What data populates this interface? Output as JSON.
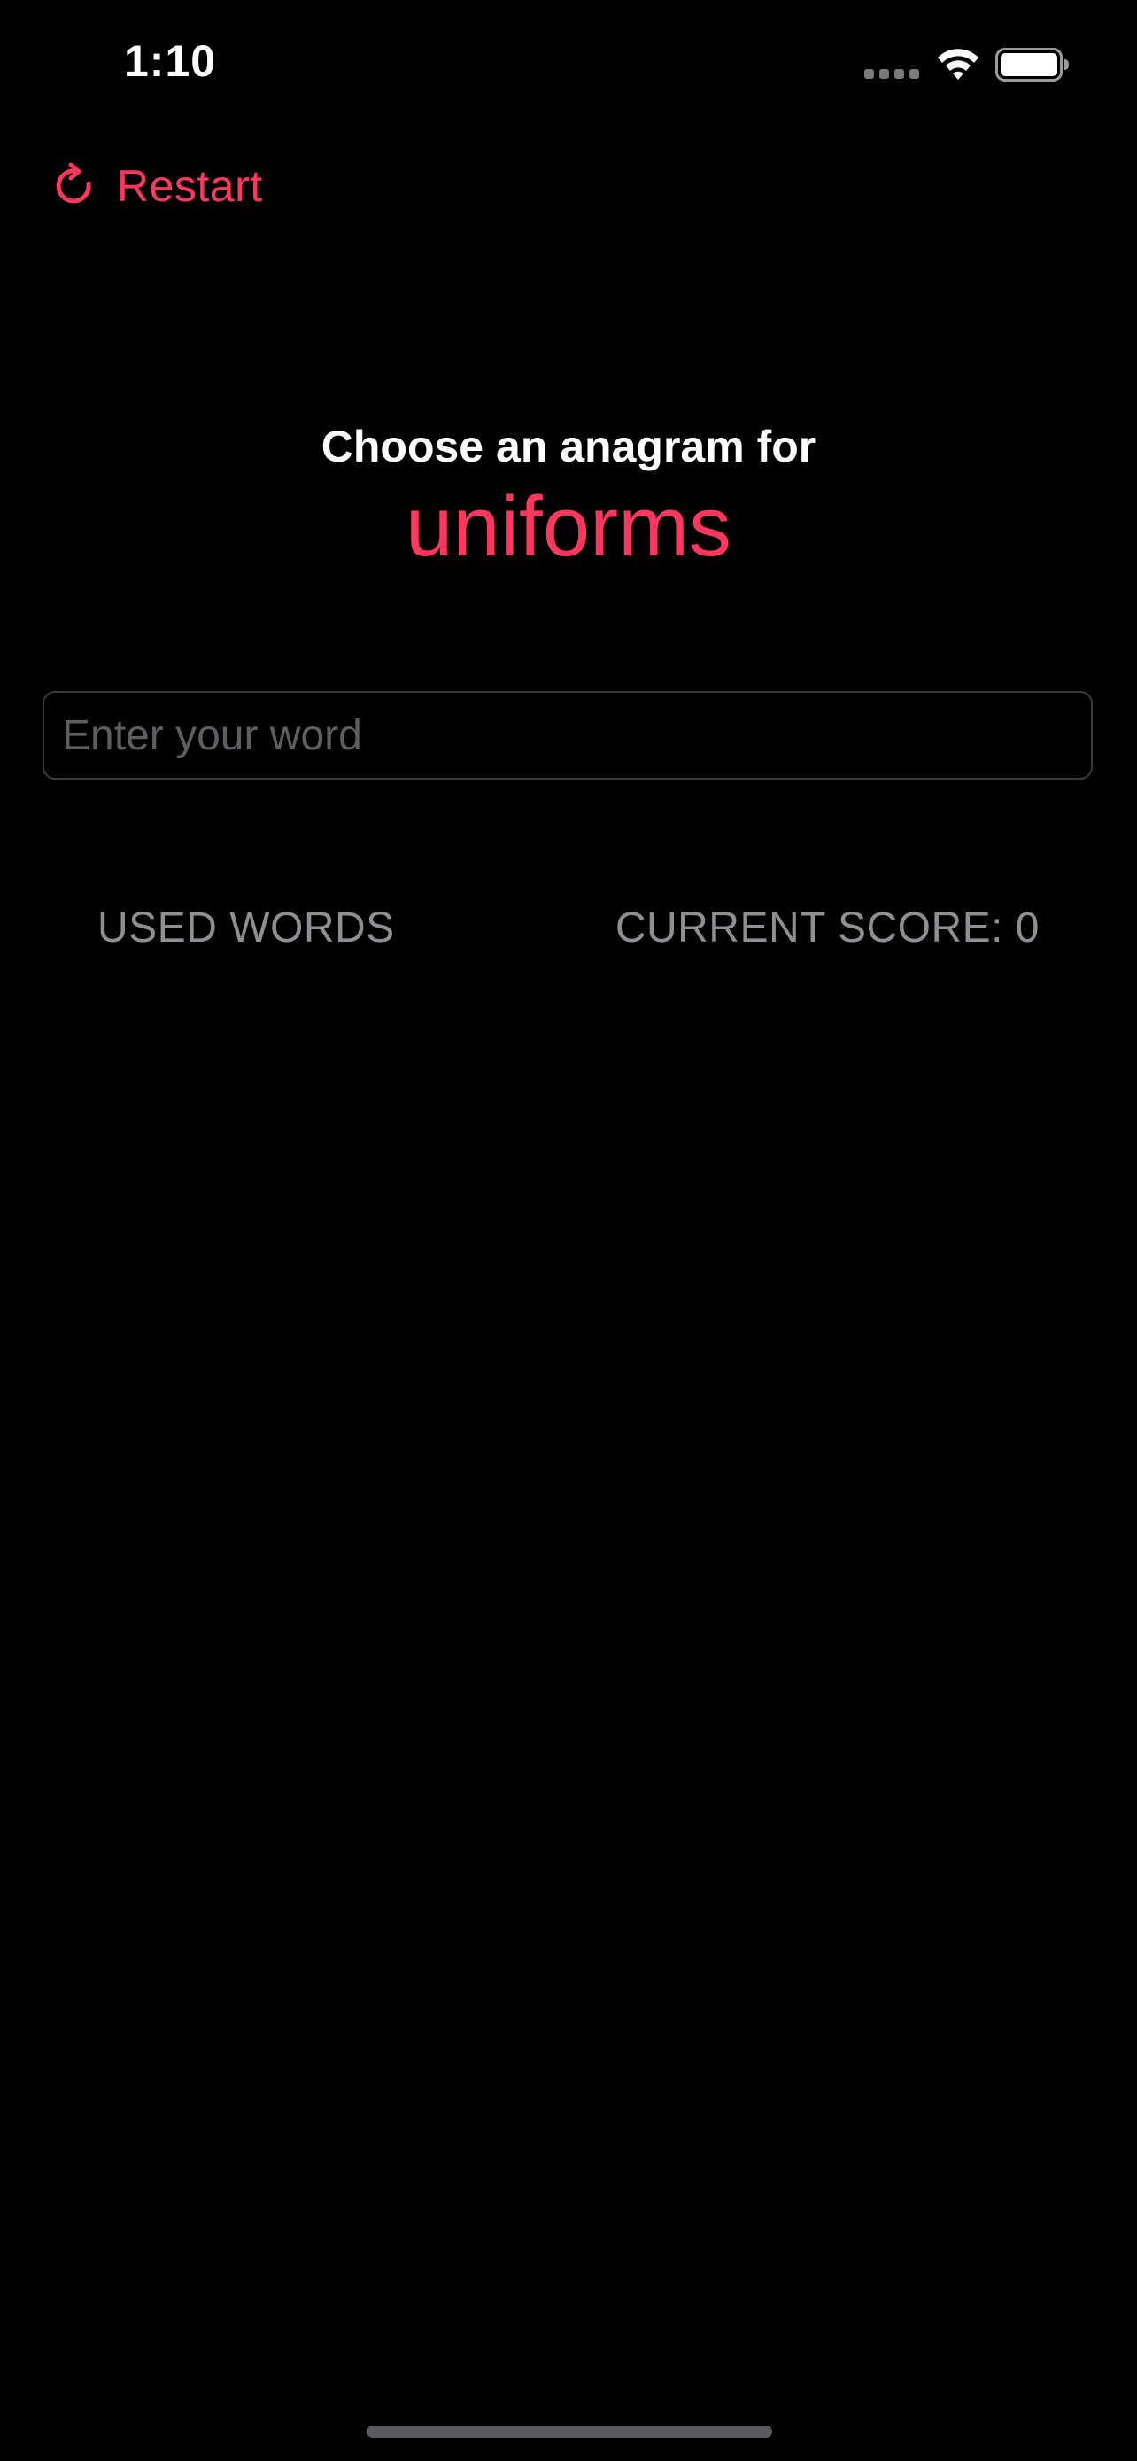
{
  "status_bar": {
    "time": "1:10",
    "icons": [
      "cellular-signal-icon",
      "wifi-icon",
      "battery-icon"
    ]
  },
  "toolbar": {
    "restart_label": "Restart",
    "restart_icon": "arrow-clockwise-icon"
  },
  "game": {
    "prompt": "Choose an anagram for",
    "root_word": "uniforms"
  },
  "input": {
    "placeholder": "Enter your word",
    "value": ""
  },
  "sections": {
    "used_words_header": "USED WORDS",
    "score_header": "CURRENT SCORE: 0"
  },
  "colors": {
    "accent": "#ff375f",
    "background": "#000000",
    "secondary_text": "#8e8e93"
  }
}
